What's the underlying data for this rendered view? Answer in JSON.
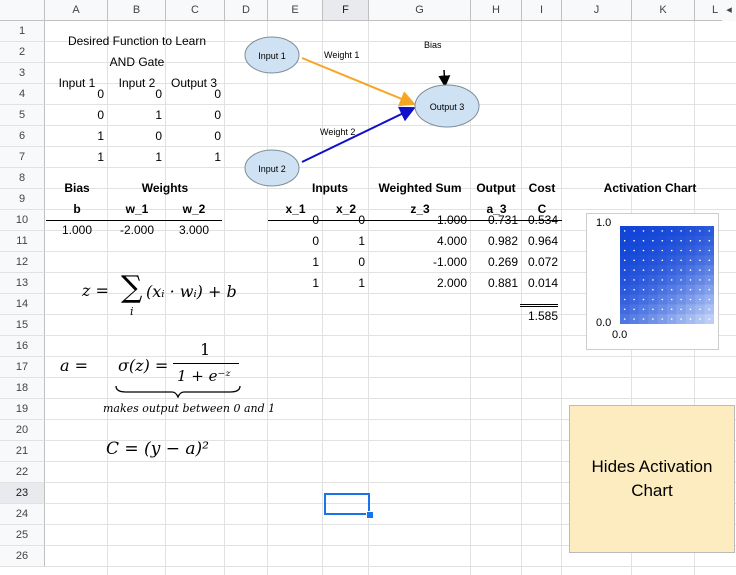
{
  "columns": [
    "A",
    "B",
    "C",
    "D",
    "E",
    "F",
    "G",
    "H",
    "I",
    "J",
    "K",
    "L"
  ],
  "rows": [
    "1",
    "2",
    "3",
    "4",
    "5",
    "6",
    "7",
    "8",
    "9",
    "10",
    "11",
    "12",
    "13",
    "14",
    "15",
    "16",
    "17",
    "18",
    "19",
    "20",
    "21",
    "22",
    "23",
    "24",
    "25",
    "26"
  ],
  "scroll_arrow": "◂",
  "title_line1": "Desired Function to Learn",
  "title_line2": "AND Gate",
  "truth_headers": [
    "Input 1",
    "Input 2",
    "Output 3"
  ],
  "truth_rows": [
    [
      "0",
      "0",
      "0"
    ],
    [
      "0",
      "1",
      "0"
    ],
    [
      "1",
      "0",
      "0"
    ],
    [
      "1",
      "1",
      "1"
    ]
  ],
  "labels": {
    "bias": "Bias",
    "weights": "Weights",
    "inputs": "Inputs",
    "weighted_sum": "Weighted Sum",
    "output": "Output",
    "cost": "Cost",
    "activation_chart": "Activation Chart"
  },
  "symbols": {
    "b": "b",
    "w_1": "w_1",
    "w_2": "w_2",
    "x_1": "x_1",
    "x_2": "x_2",
    "z_3": "z_3",
    "a_3": "a_3",
    "C": "C"
  },
  "params": {
    "b": "1.000",
    "w_1": "-2.000",
    "w_2": "3.000"
  },
  "calc_rows": [
    {
      "x1": "0",
      "x2": "0",
      "z": "1.000",
      "a": "0.731",
      "c": "0.534"
    },
    {
      "x1": "0",
      "x2": "1",
      "z": "4.000",
      "a": "0.982",
      "c": "0.964"
    },
    {
      "x1": "1",
      "x2": "0",
      "z": "-1.000",
      "a": "0.269",
      "c": "0.072"
    },
    {
      "x1": "1",
      "x2": "1",
      "z": "2.000",
      "a": "0.881",
      "c": "0.014"
    }
  ],
  "total_cost": "1.585",
  "diagram": {
    "input1": "Input 1",
    "input2": "Input 2",
    "output3": "Output 3",
    "weight1": "Weight 1",
    "weight2": "Weight 2",
    "bias": "Bias",
    "color_w1": "#f5a623",
    "color_w2": "#1010c8"
  },
  "formulas": {
    "z_lhs": "z  =",
    "sum_sym": "∑",
    "sum_sub": "i",
    "z_rhs": "(xᵢ · wᵢ)  +  b",
    "a_lhs": "a  =",
    "sigma": "σ(z)  =",
    "num": "1",
    "den": "1  +  e⁻ᶻ",
    "brace_note": "makes output between 0 and 1",
    "cost": "C  =  (y  −  a)²"
  },
  "chart": {
    "y_top": "1.0",
    "y_bottom": "0.0",
    "x_left": "0.0",
    "color_light": "#dbe8fb",
    "color_dark": "#0b3fd6"
  },
  "note": "Hides Activation Chart"
}
